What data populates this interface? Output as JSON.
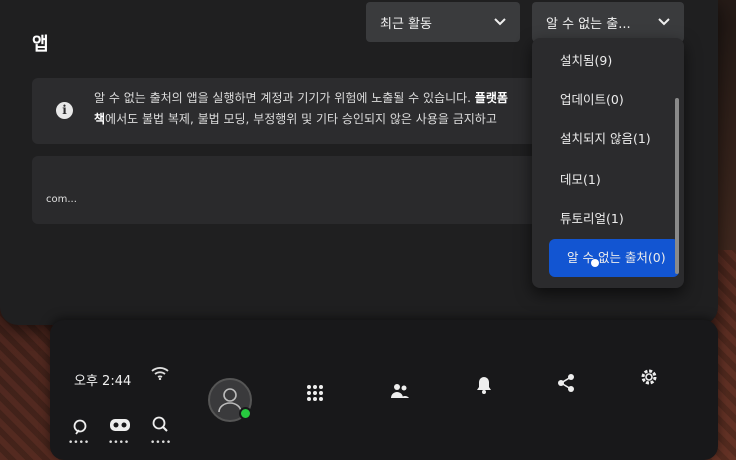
{
  "panel": {
    "title": "앱",
    "sort_select": "최근 활동",
    "filter_select": "알 수 없는 출...",
    "notice_line1": "알 수 없는 출처의 앱을 실행하면 계정과 기기가 위험에 노출될 수 있습니다. ",
    "notice_bold1": "플랫폼",
    "notice_bold2": "책",
    "notice_line2": "에서도 불법 복제, 불법 모딩, 부정행위 및 기타 승인되지 않은 사용을 금지하고",
    "app_package": "com..."
  },
  "filter_menu": {
    "items": [
      {
        "label": "설치됨(9)"
      },
      {
        "label": "업데이트(0)"
      },
      {
        "label": "설치되지 않음(1)"
      },
      {
        "label": "데모(1)"
      },
      {
        "label": "튜토리얼(1)"
      },
      {
        "label": "알 수 없는 출처(0)"
      }
    ],
    "selected_index": 5,
    "accent_color": "#1255d2"
  },
  "taskbar": {
    "time": "오후 2:44",
    "indicator_color": "#1f6ff0",
    "icons": [
      "wifi-icon",
      "avatar",
      "apps-grid-icon",
      "people-icon",
      "bell-icon",
      "share-icon",
      "gear-icon"
    ],
    "quick_icons": [
      "map-pin-icon",
      "headset-icon",
      "search-icon"
    ]
  }
}
